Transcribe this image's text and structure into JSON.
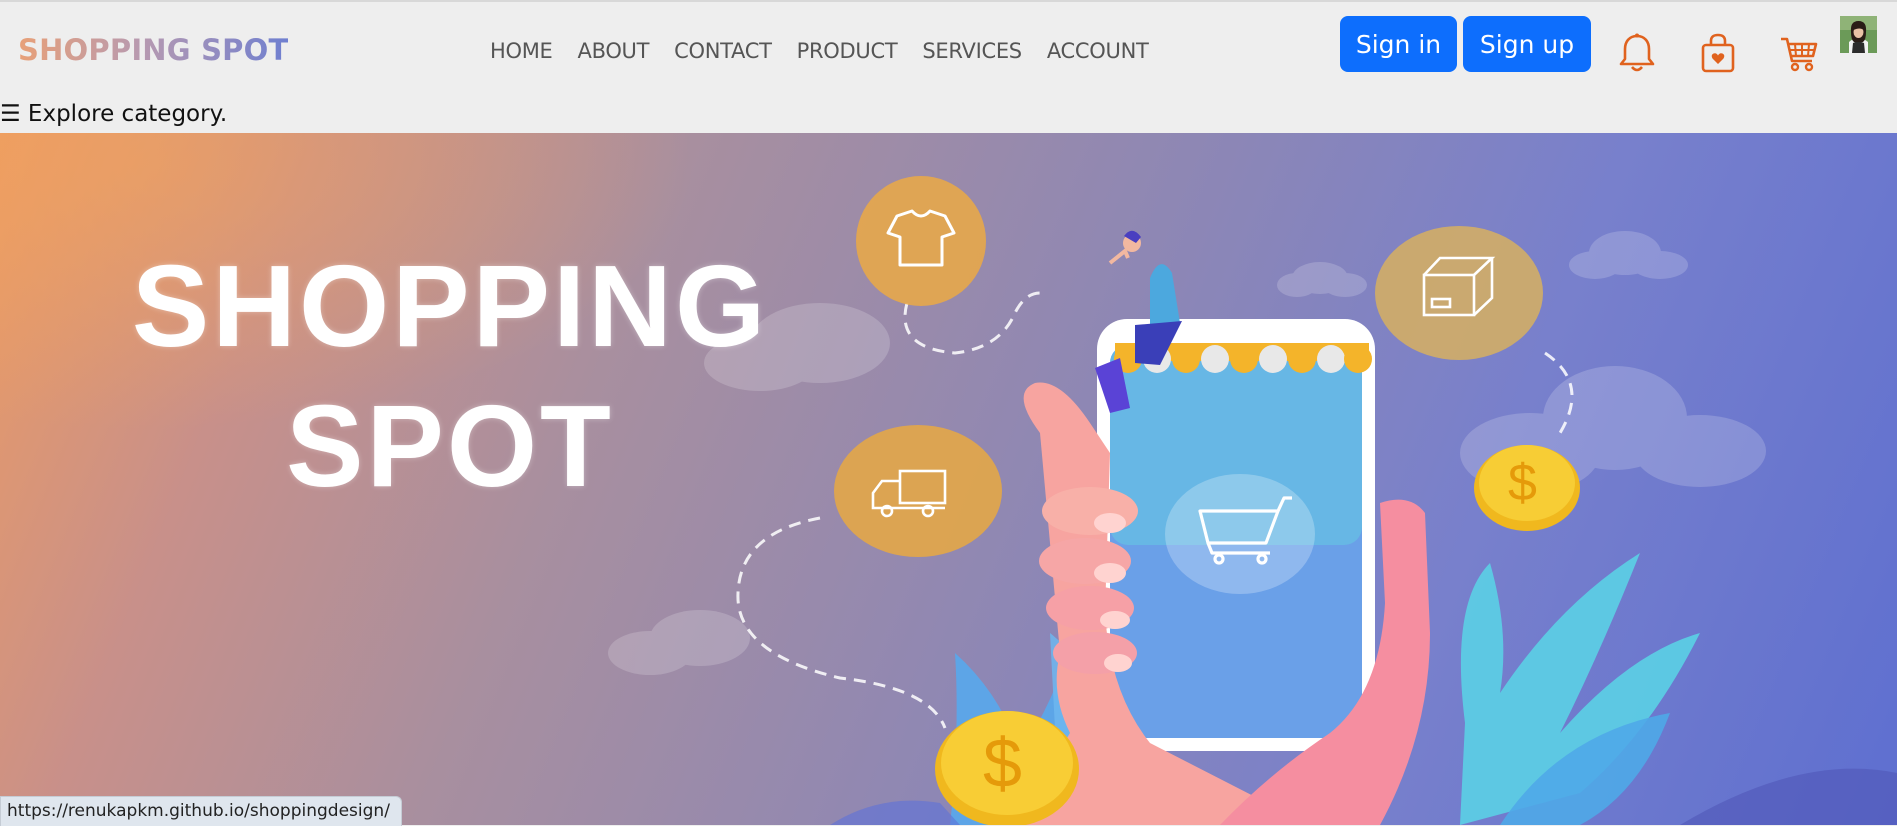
{
  "header": {
    "logo": "SHOPPING SPOT",
    "nav": [
      "HOME",
      "ABOUT",
      "CONTACT",
      "PRODUCT",
      "SERVICES",
      "ACCOUNT"
    ],
    "sign_in": "Sign in",
    "sign_up": "Sign up",
    "icons": [
      "bell-icon",
      "shopping-bag-icon",
      "cart-icon",
      "avatar"
    ]
  },
  "explore": {
    "label": "☰ Explore category."
  },
  "hero": {
    "title_line1": "SHOPPING",
    "title_line2": "SPOT",
    "badge_symbol": "$"
  },
  "status_bar": {
    "url": "https://renukapkm.github.io/shoppingdesign/"
  },
  "colors": {
    "primary_button": "#0d6efd",
    "icon_accent": "#e0621e"
  }
}
